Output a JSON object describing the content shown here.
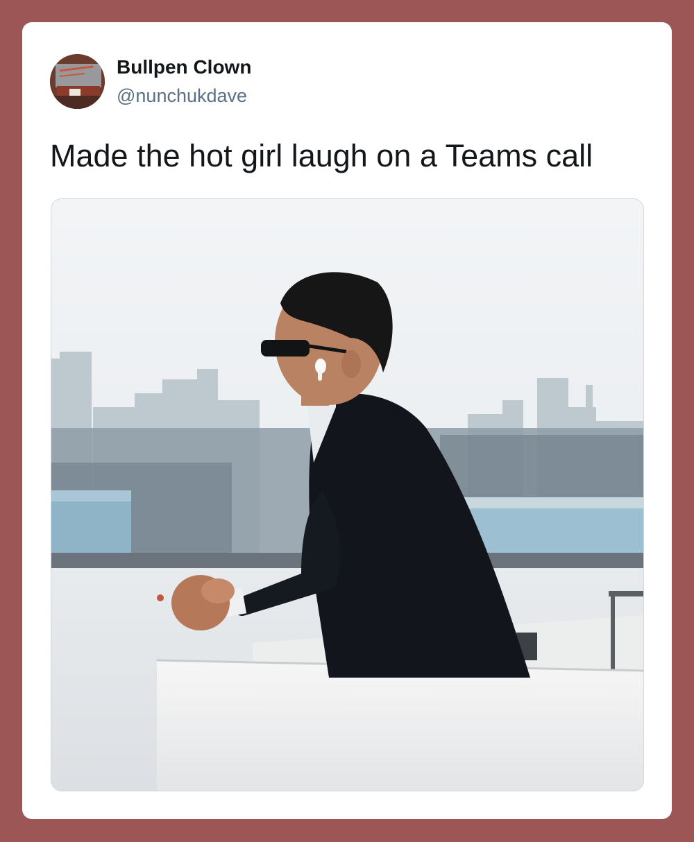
{
  "tweet": {
    "author": {
      "display_name": "Bullpen Clown",
      "handle": "@nunchukdave",
      "avatar_icon": "avatar-photo-icon"
    },
    "text": "Made the hot girl laugh on a Teams call",
    "media": {
      "kind": "photo",
      "icon": "photo-man-on-boat-icon"
    }
  },
  "colors": {
    "background": "#9c5656",
    "card": "#ffffff",
    "text_primary": "#14171a",
    "text_secondary": "#5b7083"
  }
}
